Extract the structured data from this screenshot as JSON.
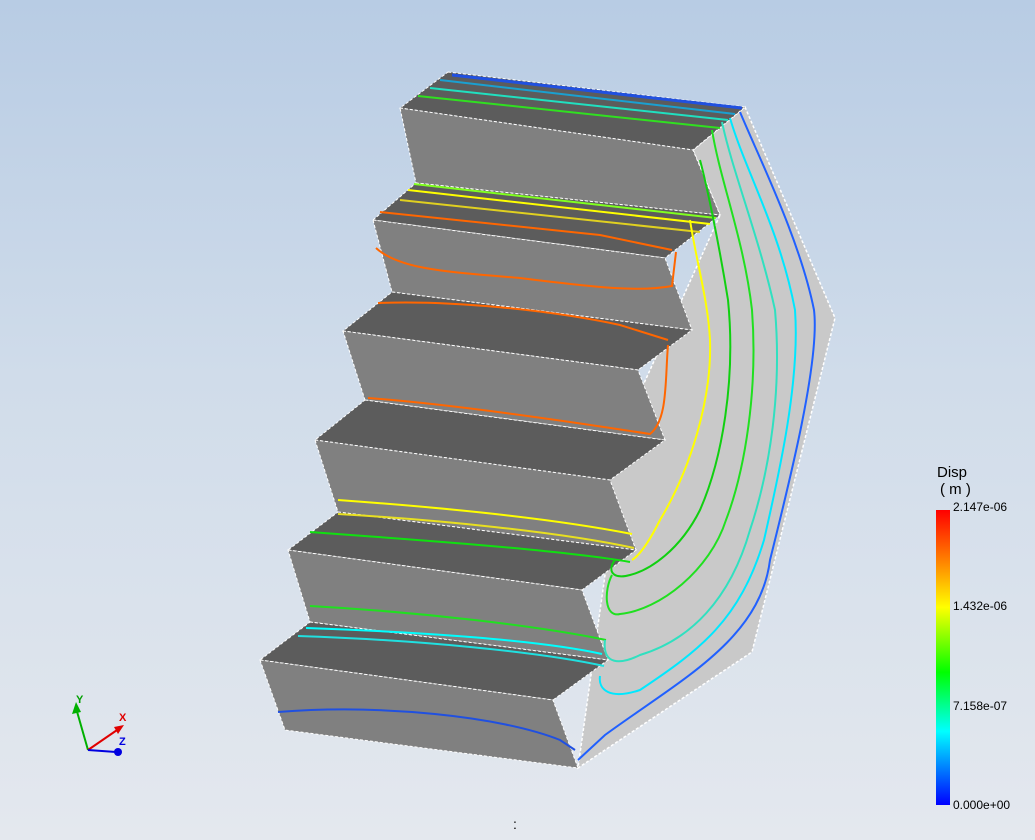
{
  "legend": {
    "title": "Disp",
    "unit": "( m )",
    "ticks": [
      "2.147e-06",
      "1.432e-06",
      "7.158e-07",
      "0.000e+00"
    ],
    "colors": {
      "max": "#ff0000",
      "upper": "#ffff00",
      "mid": "#00ff00",
      "lower": "#00ffff",
      "min": "#0000ff"
    }
  },
  "triad": {
    "x_label": "X",
    "y_label": "Y",
    "z_label": "Z"
  },
  "status": {
    "text": ":"
  }
}
